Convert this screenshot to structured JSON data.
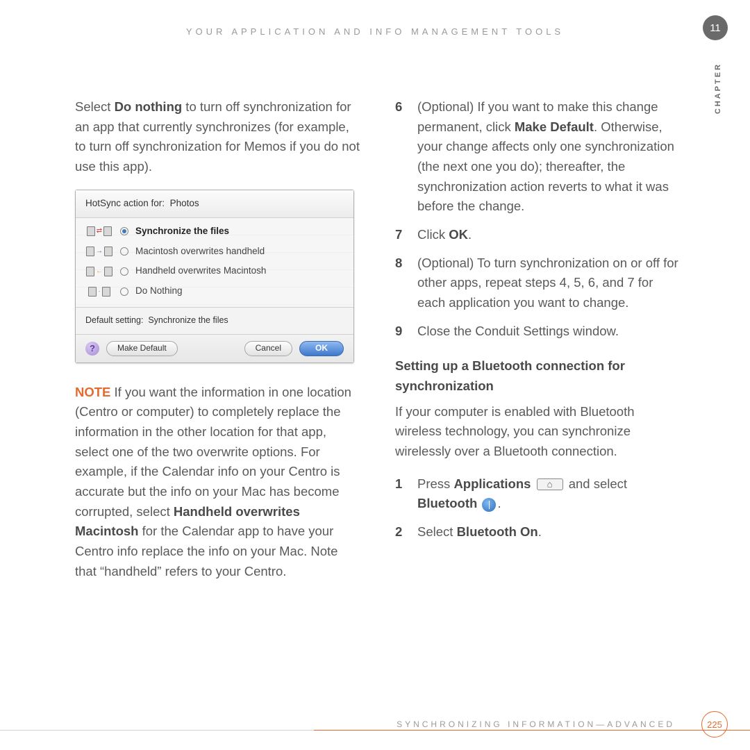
{
  "header": {
    "title": "YOUR APPLICATION AND INFO MANAGEMENT TOOLS",
    "chapter_number": "11",
    "chapter_label": "CHAPTER"
  },
  "left": {
    "p1_a": "Select ",
    "p1_b": "Do nothing",
    "p1_c": " to turn off synchronization for an app that currently synchronizes (for example, to turn off synchronization for Memos if you do not use this app).",
    "note_label": "NOTE",
    "note_body_a": " If you want the information in one location (Centro or computer) to completely replace the information in the other location for that app, select one of the two overwrite options. For example, if the Calendar info on your Centro is accurate but the info on your Mac has become corrupted, select ",
    "note_body_b": "Handheld overwrites Macintosh",
    "note_body_c": " for the Calendar app to have your Centro info replace the info on your Mac. Note that “handheld” refers to your Centro."
  },
  "dialog": {
    "header_a": "HotSync action for:",
    "header_b": "Photos",
    "opt1": "Synchronize the files",
    "opt2": "Macintosh overwrites handheld",
    "opt3": "Handheld overwrites Macintosh",
    "opt4": "Do Nothing",
    "default_a": "Default setting:",
    "default_b": "Synchronize the files",
    "btn_make_default": "Make Default",
    "btn_cancel": "Cancel",
    "btn_ok": "OK",
    "help": "?"
  },
  "right": {
    "step6_a": "(Optional)  If you want to make this change permanent, click ",
    "step6_b": "Make Default",
    "step6_c": ". Otherwise, your change affects only one synchronization (the next one you do); thereafter, the synchronization action reverts to what it was before the change.",
    "step7_a": "Click ",
    "step7_b": "OK",
    "step7_c": ".",
    "step8": "(Optional)  To turn synchronization on or off for other apps, repeat steps 4, 5, 6, and 7 for each application you want to change.",
    "step9": "Close the Conduit Settings window.",
    "sub_heading": "Setting up a Bluetooth connection for synchronization",
    "sub_para": "If your computer is enabled with Bluetooth wireless technology, you can synchronize wirelessly over a Bluetooth connection.",
    "bt1_a": "Press ",
    "bt1_b": "Applications",
    "bt1_c": " and select ",
    "bt1_d": "Bluetooth",
    "bt1_e": ".",
    "bt2_a": "Select ",
    "bt2_b": "Bluetooth On",
    "bt2_c": "."
  },
  "footer": {
    "section": "SYNCHRONIZING INFORMATION—ADVANCED",
    "page": "225"
  }
}
